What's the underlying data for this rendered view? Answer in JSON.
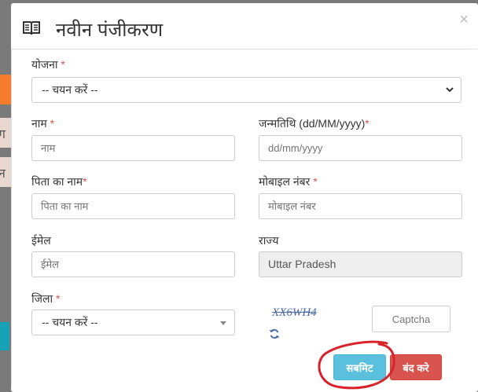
{
  "background": {
    "row1_fragment": "ग",
    "row2_fragment": "न"
  },
  "modal": {
    "title": "नवीन पंजीकरण",
    "close_glyph": "×"
  },
  "form": {
    "scheme": {
      "label": "योजना",
      "required_mark": "*",
      "selected": "-- चयन करें --"
    },
    "name": {
      "label": "नाम",
      "required_mark": "*",
      "placeholder": "नाम"
    },
    "dob": {
      "label": "जन्मतिथि (dd/MM/yyyy)",
      "required_mark": "*",
      "placeholder": "dd/mm/yyyy"
    },
    "father_name": {
      "label": "पिता का नाम",
      "required_mark": "*",
      "placeholder": "पिता का नाम"
    },
    "mobile": {
      "label": "मोबाइल नंबर",
      "required_mark": "*",
      "placeholder": "मोबाइल नंबर"
    },
    "email": {
      "label": "ईमेल",
      "placeholder": "ईमेल"
    },
    "state": {
      "label": "राज्य",
      "value": "Uttar Pradesh"
    },
    "district": {
      "label": "जिला",
      "required_mark": "*",
      "selected": "-- चयन करें --"
    },
    "captcha": {
      "image_text": "XX6WH4",
      "placeholder": "Captcha"
    }
  },
  "actions": {
    "submit_label": "सबमिट",
    "close_label": "बंद करे"
  },
  "colors": {
    "submit": "#5bc0de",
    "close": "#d9534f",
    "required": "#d9534f",
    "annotation": "#d9232b"
  }
}
